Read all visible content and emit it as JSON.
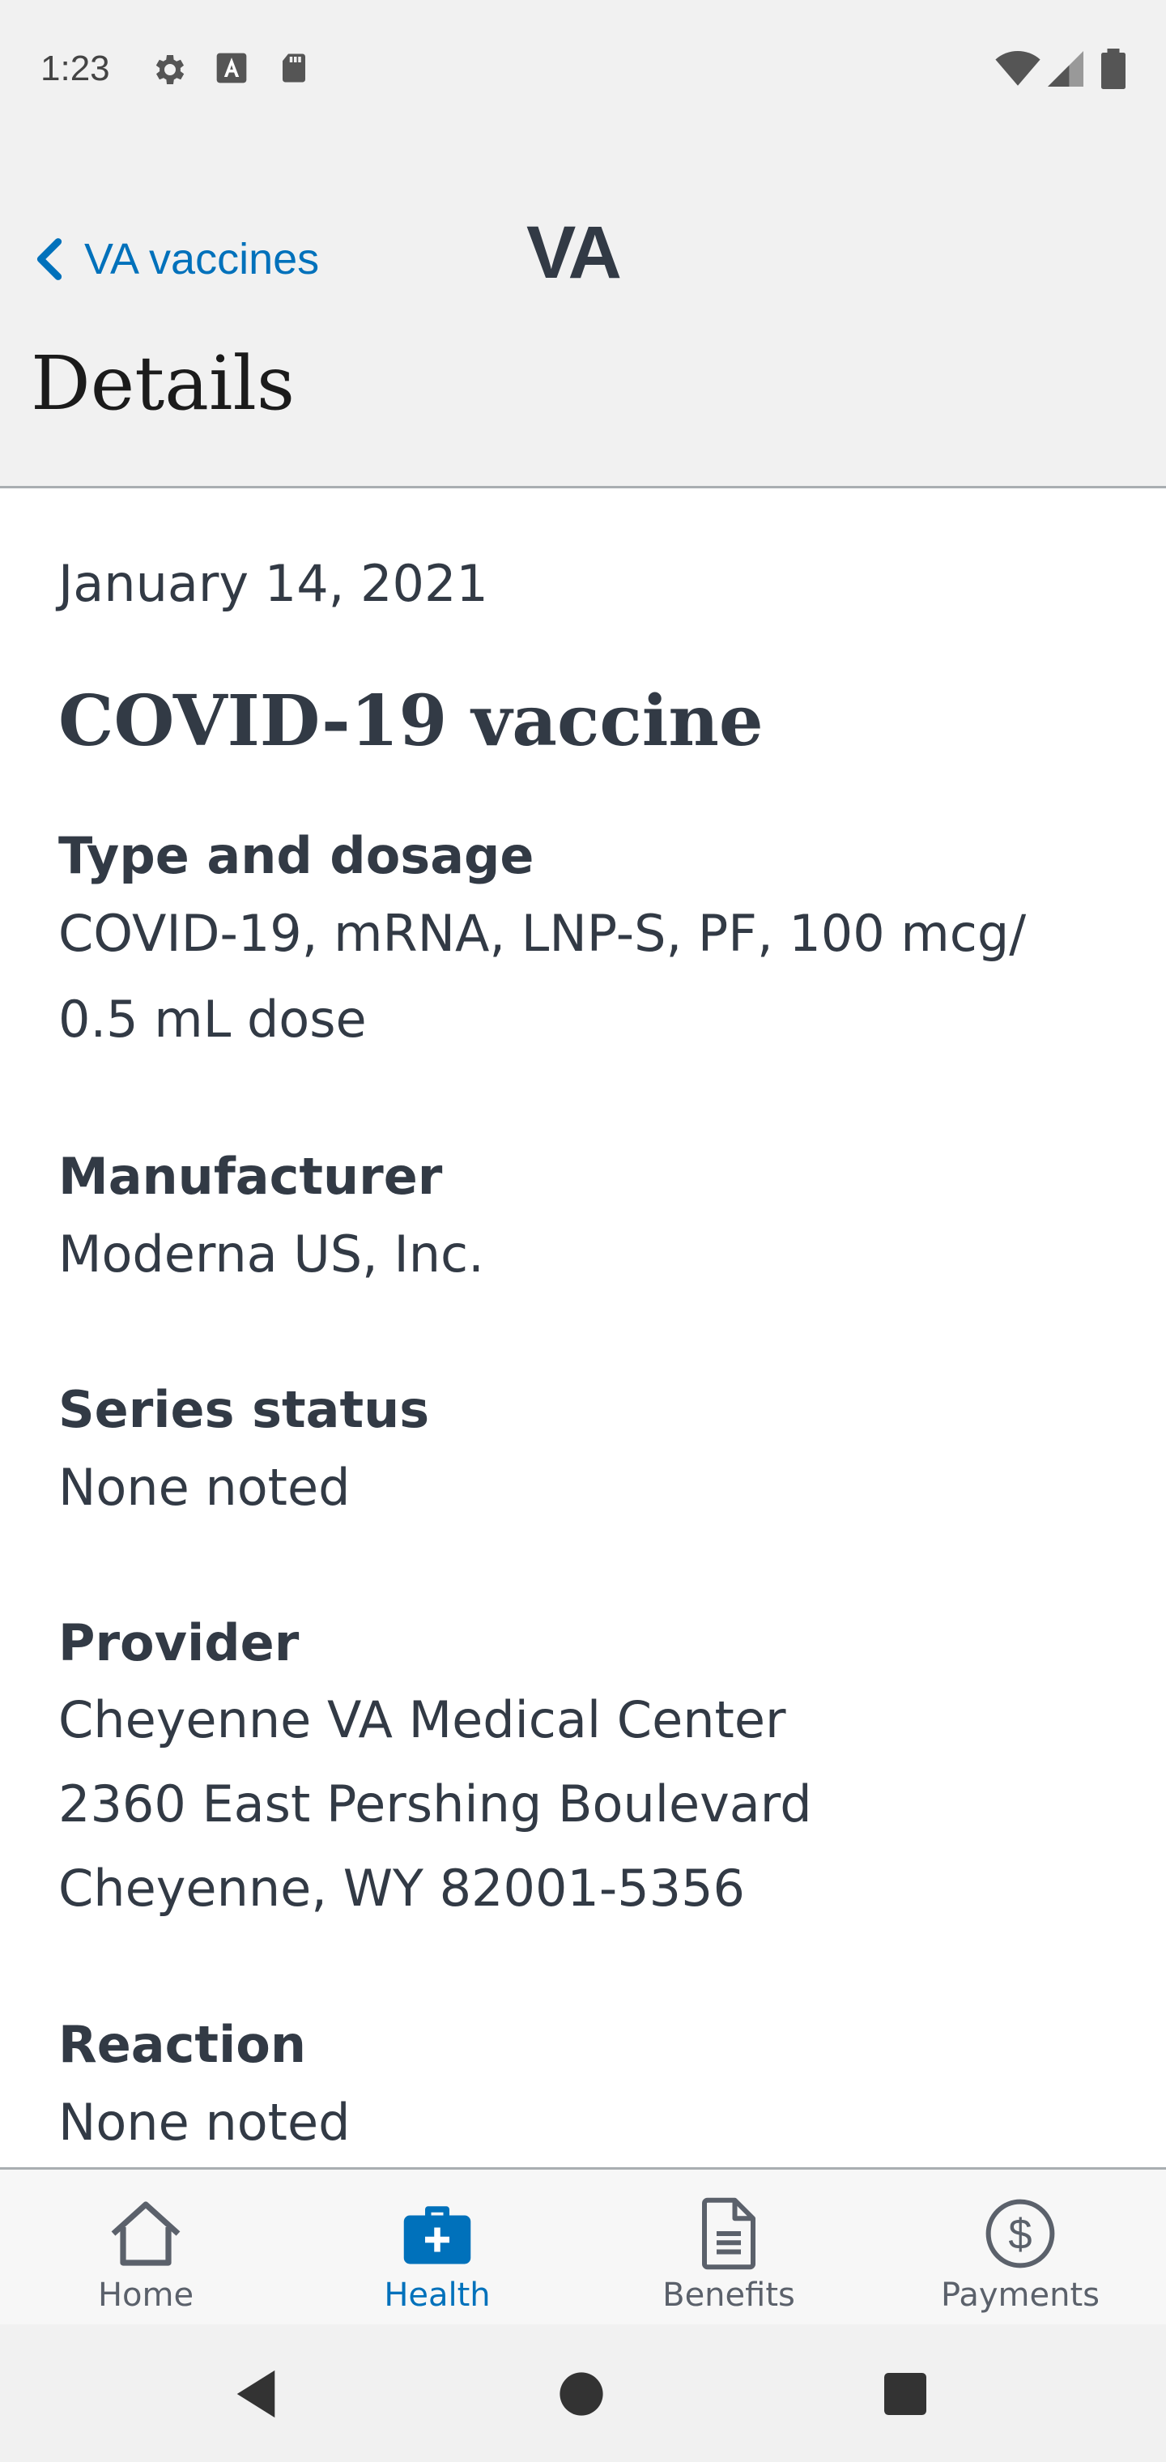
{
  "status_bar": {
    "time": "1:23",
    "left_icons": [
      "settings-icon",
      "text-a-icon",
      "sd-card-icon"
    ],
    "right_icons": [
      "wifi-icon",
      "cell-signal-icon",
      "battery-icon"
    ]
  },
  "header": {
    "back_label": "VA vaccines",
    "logo": "VA",
    "title": "Details"
  },
  "vaccine": {
    "date": "January 14, 2021",
    "name": "COVID-19 vaccine",
    "type_label": "Type and dosage",
    "type_value": "COVID-19, mRNA, LNP-S, PF, 100 mcg/ 0.5 mL dose",
    "manufacturer_label": "Manufacturer",
    "manufacturer_value": "Moderna US, Inc.",
    "series_label": "Series status",
    "series_value": "None noted",
    "provider_label": "Provider",
    "provider_line1": "Cheyenne VA Medical Center",
    "provider_line2": "2360 East Pershing Boulevard",
    "provider_line3": "Cheyenne, WY 82001-5356",
    "reaction_label": "Reaction",
    "reaction_value": "None noted"
  },
  "bottom_nav": {
    "items": [
      {
        "label": "Home",
        "icon": "home-icon",
        "active": false
      },
      {
        "label": "Health",
        "icon": "medical-kit-icon",
        "active": true
      },
      {
        "label": "Benefits",
        "icon": "document-icon",
        "active": false
      },
      {
        "label": "Payments",
        "icon": "dollar-circle-icon",
        "active": false
      }
    ]
  },
  "colors": {
    "accent": "#0071bb",
    "text": "#323a45",
    "header_bg": "#f1f1f1"
  }
}
